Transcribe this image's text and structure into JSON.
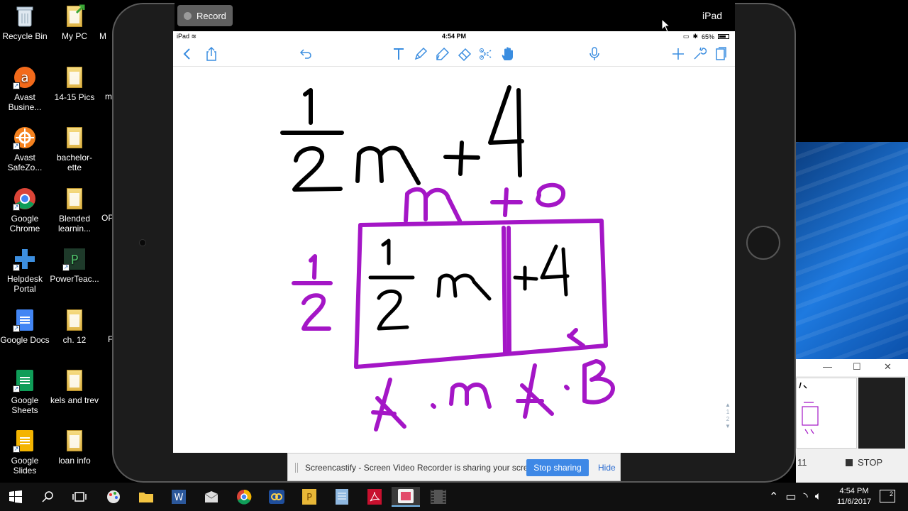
{
  "desktop": {
    "icons": [
      {
        "label": "Recycle Bin",
        "icon": "recycle-bin-icon"
      },
      {
        "label": "My PC",
        "icon": "folder-icon"
      },
      {
        "label": "Avast Busine...",
        "icon": "avast-icon"
      },
      {
        "label": "14-15 Pics",
        "icon": "folder-icon"
      },
      {
        "label": "Avast SafeZo...",
        "icon": "safezone-icon"
      },
      {
        "label": "bachelor-ette",
        "icon": "folder-icon"
      },
      {
        "label": "Google Chrome",
        "icon": "chrome-icon"
      },
      {
        "label": "Blended learnin...",
        "icon": "folder-icon"
      },
      {
        "label": "Helpdesk Portal",
        "icon": "helpdesk-icon"
      },
      {
        "label": "PowerTeac...",
        "icon": "powerteacher-icon"
      },
      {
        "label": "Google Docs",
        "icon": "google-docs-icon"
      },
      {
        "label": "ch. 12",
        "icon": "folder-icon"
      },
      {
        "label": "Google Sheets",
        "icon": "google-sheets-icon"
      },
      {
        "label": "kels and trev",
        "icon": "folder-icon"
      },
      {
        "label": "Google Slides",
        "icon": "google-slides-icon"
      },
      {
        "label": "loan info",
        "icon": "folder-icon"
      }
    ],
    "partial_labels": [
      "M",
      "m",
      "OP",
      "F"
    ]
  },
  "reflector": {
    "record_label": "Record",
    "device_name": "iPad"
  },
  "ipad": {
    "status": {
      "carrier": "iPad",
      "time": "4:54 PM",
      "battery": "65%"
    },
    "toolbar": {
      "left": [
        "back-icon",
        "share-icon",
        "undo-icon"
      ],
      "tools": [
        "text-tool-icon",
        "pen-tool-icon",
        "highlighter-tool-icon",
        "eraser-tool-icon",
        "lasso-tool-icon",
        "hand-tool-icon"
      ],
      "right": [
        "microphone-icon",
        "add-icon",
        "wrench-icon",
        "pages-icon"
      ]
    },
    "scroll_pages": [
      "1",
      "2"
    ]
  },
  "mini_window": {
    "controls": [
      "—",
      "☐",
      "✕"
    ],
    "partial_number": "11",
    "stop_label": "STOP"
  },
  "sharebar": {
    "message": "Screencastify - Screen Video Recorder is sharing your screen.",
    "stop_label": "Stop sharing",
    "hide_label": "Hide"
  },
  "taskbar": {
    "apps": [
      "start-icon",
      "search-icon",
      "task-view-icon",
      "paint-3d-icon",
      "file-explorer-icon",
      "word-icon",
      "outlook-icon",
      "chrome-icon",
      "reflector-icon",
      "powerteacher-icon",
      "notepad-icon",
      "acrobat-icon",
      "screencast-icon",
      "video-icon"
    ],
    "clock_time": "4:54 PM",
    "clock_date": "11/6/2017",
    "notifications": "2"
  },
  "colors": {
    "accent_blue": "#3e88e6",
    "ink_purple": "#a416c6",
    "ink_black": "#000000"
  }
}
